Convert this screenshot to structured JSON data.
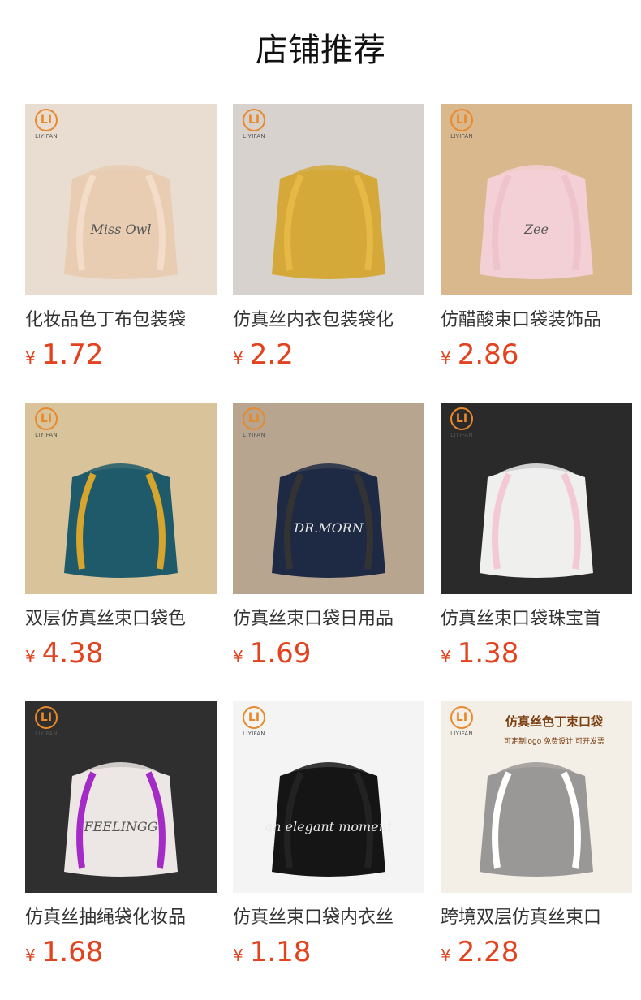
{
  "section": {
    "title": "店铺推荐"
  },
  "brand_logo": {
    "mark": "LI",
    "text": "LIYIFAN"
  },
  "products": [
    {
      "name": "化妆品色丁布包装袋",
      "currency": "¥",
      "price": "1.72",
      "image": "beige-satin-drawstring-bags",
      "bg": "#e9dcd0",
      "bag": "#e8cdb3",
      "ribbon": "#f3dcc8",
      "print": "Miss Owl"
    },
    {
      "name": "仿真丝内衣包装袋化",
      "currency": "¥",
      "price": "2.2",
      "image": "gold-satin-drawstring-bag",
      "bg": "#d8d2cf",
      "bag": "#d4a93a",
      "ribbon": "#e6b845",
      "print": ""
    },
    {
      "name": "仿醋酸束口袋装饰品",
      "currency": "¥",
      "price": "2.86",
      "image": "pink-satin-drawstring-bag",
      "bg": "#d9b88d",
      "bag": "#f3cfd6",
      "ribbon": "#efc3cb",
      "print": "Zee"
    },
    {
      "name": "双层仿真丝束口袋色",
      "currency": "¥",
      "price": "4.38",
      "image": "colored-satin-pouches-on-mat",
      "bg": "#d8c39a",
      "bag": "#1f5a6a",
      "ribbon": "#d6a52d",
      "print": ""
    },
    {
      "name": "仿真丝束口袋日用品",
      "currency": "¥",
      "price": "1.69",
      "image": "black-navy-white-satin-bags",
      "bg": "#b8a58f",
      "bag": "#1e2a44",
      "ribbon": "#333333",
      "print": "DR.MORN"
    },
    {
      "name": "仿真丝束口袋珠宝首",
      "currency": "¥",
      "price": "1.38",
      "image": "white-satin-drawstring-bags",
      "bg": "#2a2a2a",
      "bag": "#efefee",
      "ribbon": "#f2c9d4",
      "print": ""
    },
    {
      "name": "仿真丝抽绳袋化妆品",
      "currency": "¥",
      "price": "1.68",
      "image": "white-pouch-purple-ribbon",
      "bg": "#2f2f2f",
      "bag": "#ece6e4",
      "ribbon": "#a52bc6",
      "print": "FEELINGG"
    },
    {
      "name": "仿真丝束口袋内衣丝",
      "currency": "¥",
      "price": "1.18",
      "image": "black-satin-drawstring-bag",
      "bg": "#f4f4f4",
      "bag": "#151515",
      "ribbon": "#222222",
      "print": "an elegant moment"
    },
    {
      "name": "跨境双层仿真丝束口",
      "currency": "¥",
      "price": "2.28",
      "image": "grey-satin-drawstring-bag",
      "bg": "#f3eee6",
      "bag": "#9a9896",
      "ribbon": "#ffffff",
      "print": "",
      "banner_title": "仿真丝色丁束口袋",
      "banner_sub": "可定制logo 免费设计 可开发票"
    }
  ]
}
